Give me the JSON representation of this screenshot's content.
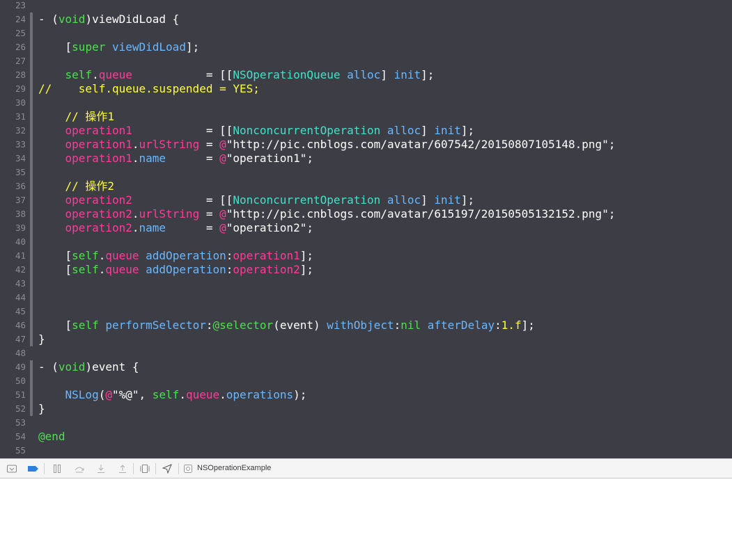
{
  "colors": {
    "background": "#3d3d45",
    "plain": "#ffffff",
    "keyword": "#4ee04e",
    "property": "#ff3d9a",
    "method": "#6ab8ff",
    "class": "#46e0c8",
    "string": "#ffffff",
    "comment": "#ffff3f",
    "line_number": "#8c8c96"
  },
  "editor": {
    "lines": [
      {
        "n": "23",
        "fold": false,
        "tokens": []
      },
      {
        "n": "24",
        "fold": true,
        "tokens": [
          {
            "t": "- (",
            "c": "plain"
          },
          {
            "t": "void",
            "c": "keyword"
          },
          {
            "t": ")viewDidLoad {",
            "c": "plain"
          }
        ]
      },
      {
        "n": "25",
        "fold": true,
        "tokens": []
      },
      {
        "n": "26",
        "fold": true,
        "tokens": [
          {
            "t": "    [",
            "c": "plain"
          },
          {
            "t": "super",
            "c": "keyword"
          },
          {
            "t": " ",
            "c": "plain"
          },
          {
            "t": "viewDidLoad",
            "c": "method"
          },
          {
            "t": "];",
            "c": "plain"
          }
        ]
      },
      {
        "n": "27",
        "fold": true,
        "tokens": []
      },
      {
        "n": "28",
        "fold": true,
        "tokens": [
          {
            "t": "    ",
            "c": "plain"
          },
          {
            "t": "self",
            "c": "keyword"
          },
          {
            "t": ".",
            "c": "plain"
          },
          {
            "t": "queue",
            "c": "property"
          },
          {
            "t": "           = [[",
            "c": "plain"
          },
          {
            "t": "NSOperationQueue",
            "c": "class"
          },
          {
            "t": " ",
            "c": "plain"
          },
          {
            "t": "alloc",
            "c": "method"
          },
          {
            "t": "] ",
            "c": "plain"
          },
          {
            "t": "init",
            "c": "method"
          },
          {
            "t": "];",
            "c": "plain"
          }
        ]
      },
      {
        "n": "29",
        "fold": true,
        "tokens": [
          {
            "t": "//    self.queue.suspended = YES;",
            "c": "comment"
          }
        ]
      },
      {
        "n": "30",
        "fold": true,
        "tokens": []
      },
      {
        "n": "31",
        "fold": true,
        "tokens": [
          {
            "t": "    // 操作1",
            "c": "comment"
          }
        ]
      },
      {
        "n": "32",
        "fold": true,
        "tokens": [
          {
            "t": "    ",
            "c": "plain"
          },
          {
            "t": "operation1",
            "c": "property"
          },
          {
            "t": "           = [[",
            "c": "plain"
          },
          {
            "t": "NonconcurrentOperation",
            "c": "class"
          },
          {
            "t": " ",
            "c": "plain"
          },
          {
            "t": "alloc",
            "c": "method"
          },
          {
            "t": "] ",
            "c": "plain"
          },
          {
            "t": "init",
            "c": "method"
          },
          {
            "t": "];",
            "c": "plain"
          }
        ]
      },
      {
        "n": "33",
        "fold": true,
        "tokens": [
          {
            "t": "    ",
            "c": "plain"
          },
          {
            "t": "operation1",
            "c": "property"
          },
          {
            "t": ".",
            "c": "plain"
          },
          {
            "t": "urlString",
            "c": "property"
          },
          {
            "t": " = ",
            "c": "plain"
          },
          {
            "t": "@",
            "c": "property"
          },
          {
            "t": "\"http://pic.cnblogs.com/avatar/607542/20150807105148.png\"",
            "c": "string"
          },
          {
            "t": ";",
            "c": "plain"
          }
        ]
      },
      {
        "n": "34",
        "fold": true,
        "tokens": [
          {
            "t": "    ",
            "c": "plain"
          },
          {
            "t": "operation1",
            "c": "property"
          },
          {
            "t": ".",
            "c": "plain"
          },
          {
            "t": "name",
            "c": "method"
          },
          {
            "t": "      = ",
            "c": "plain"
          },
          {
            "t": "@",
            "c": "property"
          },
          {
            "t": "\"operation1\"",
            "c": "string"
          },
          {
            "t": ";",
            "c": "plain"
          }
        ]
      },
      {
        "n": "35",
        "fold": true,
        "tokens": []
      },
      {
        "n": "36",
        "fold": true,
        "tokens": [
          {
            "t": "    // 操作2",
            "c": "comment"
          }
        ]
      },
      {
        "n": "37",
        "fold": true,
        "tokens": [
          {
            "t": "    ",
            "c": "plain"
          },
          {
            "t": "operation2",
            "c": "property"
          },
          {
            "t": "           = [[",
            "c": "plain"
          },
          {
            "t": "NonconcurrentOperation",
            "c": "class"
          },
          {
            "t": " ",
            "c": "plain"
          },
          {
            "t": "alloc",
            "c": "method"
          },
          {
            "t": "] ",
            "c": "plain"
          },
          {
            "t": "init",
            "c": "method"
          },
          {
            "t": "];",
            "c": "plain"
          }
        ]
      },
      {
        "n": "38",
        "fold": true,
        "tokens": [
          {
            "t": "    ",
            "c": "plain"
          },
          {
            "t": "operation2",
            "c": "property"
          },
          {
            "t": ".",
            "c": "plain"
          },
          {
            "t": "urlString",
            "c": "property"
          },
          {
            "t": " = ",
            "c": "plain"
          },
          {
            "t": "@",
            "c": "property"
          },
          {
            "t": "\"http://pic.cnblogs.com/avatar/615197/20150505132152.png\"",
            "c": "string"
          },
          {
            "t": ";",
            "c": "plain"
          }
        ]
      },
      {
        "n": "39",
        "fold": true,
        "tokens": [
          {
            "t": "    ",
            "c": "plain"
          },
          {
            "t": "operation2",
            "c": "property"
          },
          {
            "t": ".",
            "c": "plain"
          },
          {
            "t": "name",
            "c": "method"
          },
          {
            "t": "      = ",
            "c": "plain"
          },
          {
            "t": "@",
            "c": "property"
          },
          {
            "t": "\"operation2\"",
            "c": "string"
          },
          {
            "t": ";",
            "c": "plain"
          }
        ]
      },
      {
        "n": "40",
        "fold": true,
        "tokens": []
      },
      {
        "n": "41",
        "fold": true,
        "tokens": [
          {
            "t": "    [",
            "c": "plain"
          },
          {
            "t": "self",
            "c": "keyword"
          },
          {
            "t": ".",
            "c": "plain"
          },
          {
            "t": "queue",
            "c": "property"
          },
          {
            "t": " ",
            "c": "plain"
          },
          {
            "t": "addOperation",
            "c": "method"
          },
          {
            "t": ":",
            "c": "plain"
          },
          {
            "t": "operation1",
            "c": "property"
          },
          {
            "t": "];",
            "c": "plain"
          }
        ]
      },
      {
        "n": "42",
        "fold": true,
        "tokens": [
          {
            "t": "    [",
            "c": "plain"
          },
          {
            "t": "self",
            "c": "keyword"
          },
          {
            "t": ".",
            "c": "plain"
          },
          {
            "t": "queue",
            "c": "property"
          },
          {
            "t": " ",
            "c": "plain"
          },
          {
            "t": "addOperation",
            "c": "method"
          },
          {
            "t": ":",
            "c": "plain"
          },
          {
            "t": "operation2",
            "c": "property"
          },
          {
            "t": "];",
            "c": "plain"
          }
        ]
      },
      {
        "n": "43",
        "fold": true,
        "tokens": []
      },
      {
        "n": "44",
        "fold": true,
        "tokens": []
      },
      {
        "n": "45",
        "fold": true,
        "tokens": []
      },
      {
        "n": "46",
        "fold": true,
        "tokens": [
          {
            "t": "    [",
            "c": "plain"
          },
          {
            "t": "self",
            "c": "keyword"
          },
          {
            "t": " ",
            "c": "plain"
          },
          {
            "t": "performSelector",
            "c": "method"
          },
          {
            "t": ":",
            "c": "plain"
          },
          {
            "t": "@selector",
            "c": "keyword"
          },
          {
            "t": "(event) ",
            "c": "plain"
          },
          {
            "t": "withObject",
            "c": "method"
          },
          {
            "t": ":",
            "c": "plain"
          },
          {
            "t": "nil",
            "c": "keyword"
          },
          {
            "t": " ",
            "c": "plain"
          },
          {
            "t": "afterDelay",
            "c": "method"
          },
          {
            "t": ":",
            "c": "plain"
          },
          {
            "t": "1.f",
            "c": "comment"
          },
          {
            "t": "];",
            "c": "plain"
          }
        ]
      },
      {
        "n": "47",
        "fold": true,
        "tokens": [
          {
            "t": "}",
            "c": "plain"
          }
        ]
      },
      {
        "n": "48",
        "fold": false,
        "tokens": []
      },
      {
        "n": "49",
        "fold": true,
        "tokens": [
          {
            "t": "- (",
            "c": "plain"
          },
          {
            "t": "void",
            "c": "keyword"
          },
          {
            "t": ")event {",
            "c": "plain"
          }
        ]
      },
      {
        "n": "50",
        "fold": true,
        "tokens": []
      },
      {
        "n": "51",
        "fold": true,
        "tokens": [
          {
            "t": "    ",
            "c": "plain"
          },
          {
            "t": "NSLog",
            "c": "method"
          },
          {
            "t": "(",
            "c": "plain"
          },
          {
            "t": "@",
            "c": "property"
          },
          {
            "t": "\"%@\"",
            "c": "string"
          },
          {
            "t": ", ",
            "c": "plain"
          },
          {
            "t": "self",
            "c": "keyword"
          },
          {
            "t": ".",
            "c": "plain"
          },
          {
            "t": "queue",
            "c": "property"
          },
          {
            "t": ".",
            "c": "plain"
          },
          {
            "t": "operations",
            "c": "method"
          },
          {
            "t": ");",
            "c": "plain"
          }
        ]
      },
      {
        "n": "52",
        "fold": true,
        "tokens": [
          {
            "t": "}",
            "c": "plain"
          }
        ]
      },
      {
        "n": "53",
        "fold": false,
        "tokens": []
      },
      {
        "n": "54",
        "fold": false,
        "tokens": [
          {
            "t": "@end",
            "c": "keyword"
          }
        ]
      },
      {
        "n": "55",
        "fold": false,
        "tokens": []
      }
    ]
  },
  "debug_bar": {
    "buttons": [
      {
        "name": "hide-debug-area-button",
        "icon": "tray-down-icon"
      },
      {
        "name": "breakpoints-toggle-button",
        "icon": "breakpoint-icon"
      },
      {
        "name": "pause-button",
        "icon": "pause-icon"
      },
      {
        "name": "step-over-button",
        "icon": "step-over-icon"
      },
      {
        "name": "step-into-button",
        "icon": "step-into-icon"
      },
      {
        "name": "step-out-button",
        "icon": "step-out-icon"
      },
      {
        "name": "view-debugger-button",
        "icon": "view-hierarchy-icon"
      },
      {
        "name": "simulate-location-button",
        "icon": "location-arrow-icon"
      }
    ],
    "target_label": "NSOperationExample"
  }
}
